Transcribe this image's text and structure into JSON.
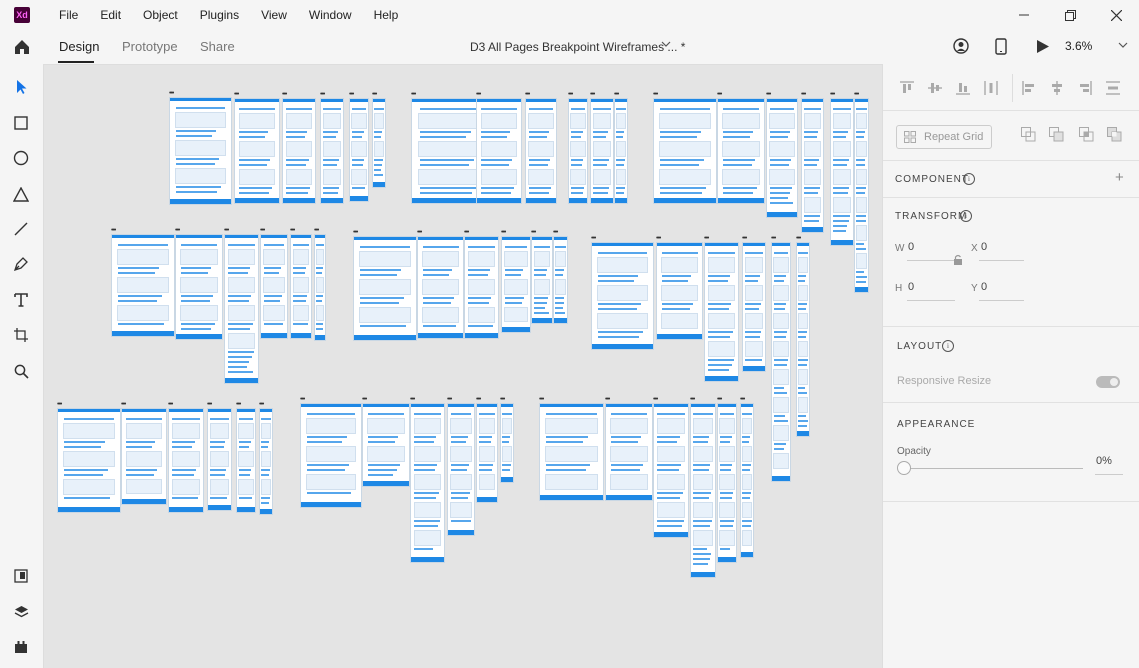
{
  "app": {
    "icon_label": "Xd"
  },
  "menu": [
    "File",
    "Edit",
    "Object",
    "Plugins",
    "View",
    "Window",
    "Help"
  ],
  "toolbar": {
    "tabs": {
      "design": "Design",
      "prototype": "Prototype",
      "share": "Share"
    },
    "document_title": "D3 All Pages Breakpoint Wireframes ... *",
    "zoom": "3.6%"
  },
  "panel": {
    "repeat_grid": "Repeat Grid",
    "component": {
      "title": "COMPONENT",
      "info": "i",
      "add": "+"
    },
    "transform": {
      "title": "TRANSFORM",
      "info": "i",
      "w_label": "W",
      "w_value": "0",
      "x_label": "X",
      "x_value": "0",
      "h_label": "H",
      "h_value": "0",
      "y_label": "Y",
      "y_value": "0"
    },
    "layout": {
      "title": "LAYOUT",
      "info": "i",
      "responsive_resize": "Responsive Resize"
    },
    "appearance": {
      "title": "APPEARANCE",
      "opacity_label": "Opacity",
      "opacity_value": "0%"
    }
  },
  "colors": {
    "accent": "#1e88e5",
    "canvas": "#e4e4e4",
    "chrome": "#f5f5f5"
  }
}
